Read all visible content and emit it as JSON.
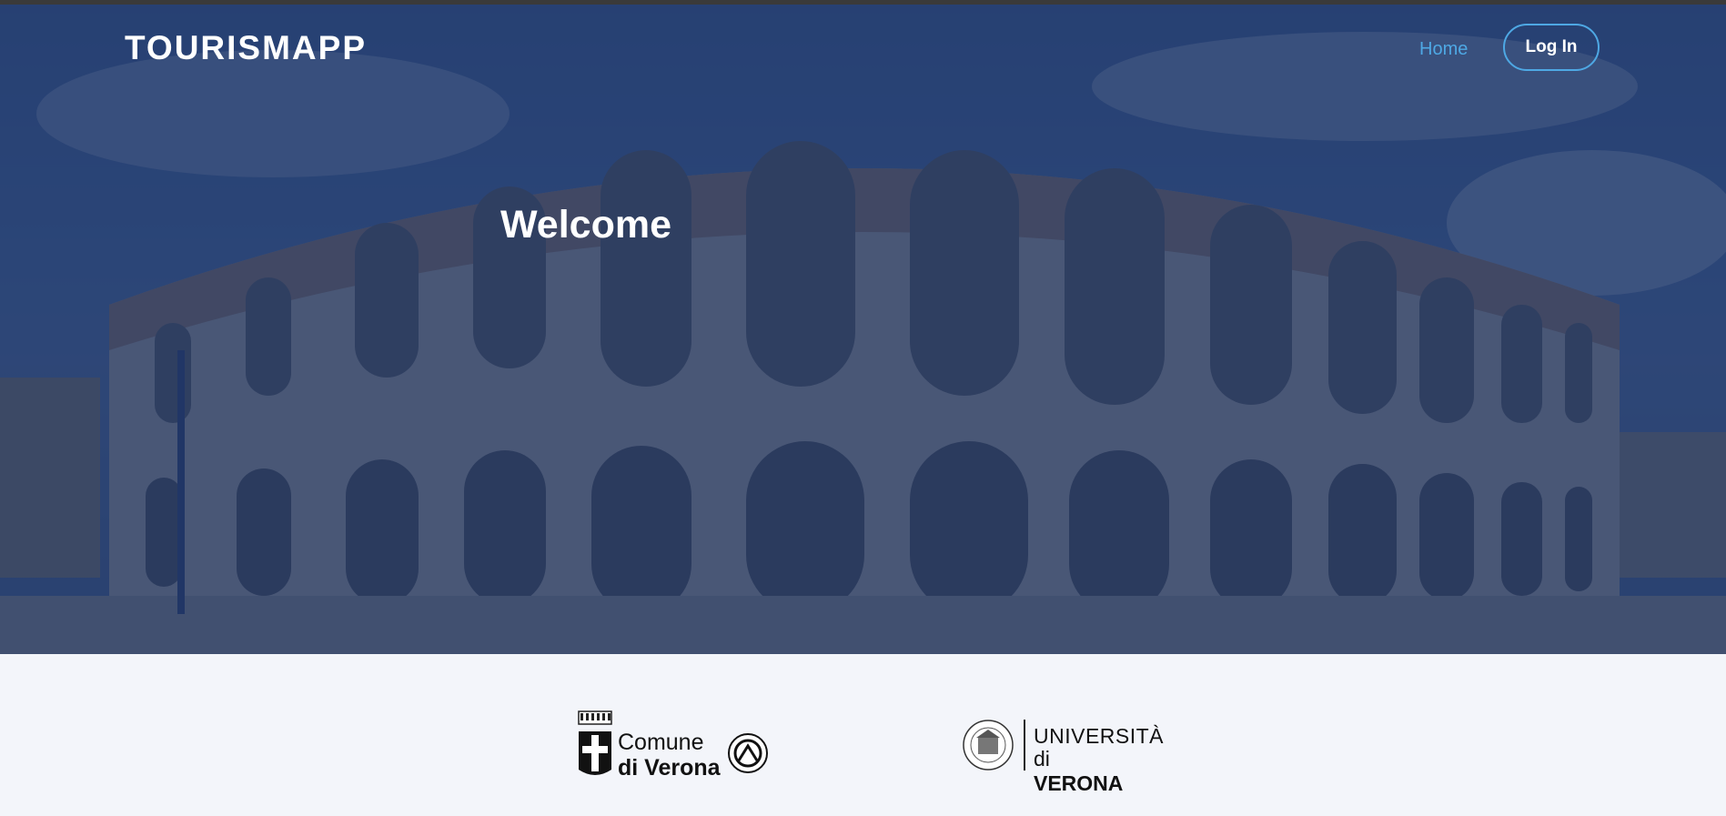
{
  "navbar": {
    "brand": "TOURISMAPP",
    "home_link": "Home",
    "login_button": "Log In"
  },
  "hero": {
    "title": "Welcome",
    "background_image": "verona-arena-photo"
  },
  "logos": {
    "comune": {
      "line1": "Comune",
      "line2": "di Verona"
    },
    "univr": {
      "line1": "UNIVERSITÀ",
      "line2_prefix": "di ",
      "line2_bold": "VERONA"
    }
  },
  "colors": {
    "overlay": "#1e3464",
    "accent": "#4ea8e4",
    "footer_bg": "#f3f5fa"
  }
}
